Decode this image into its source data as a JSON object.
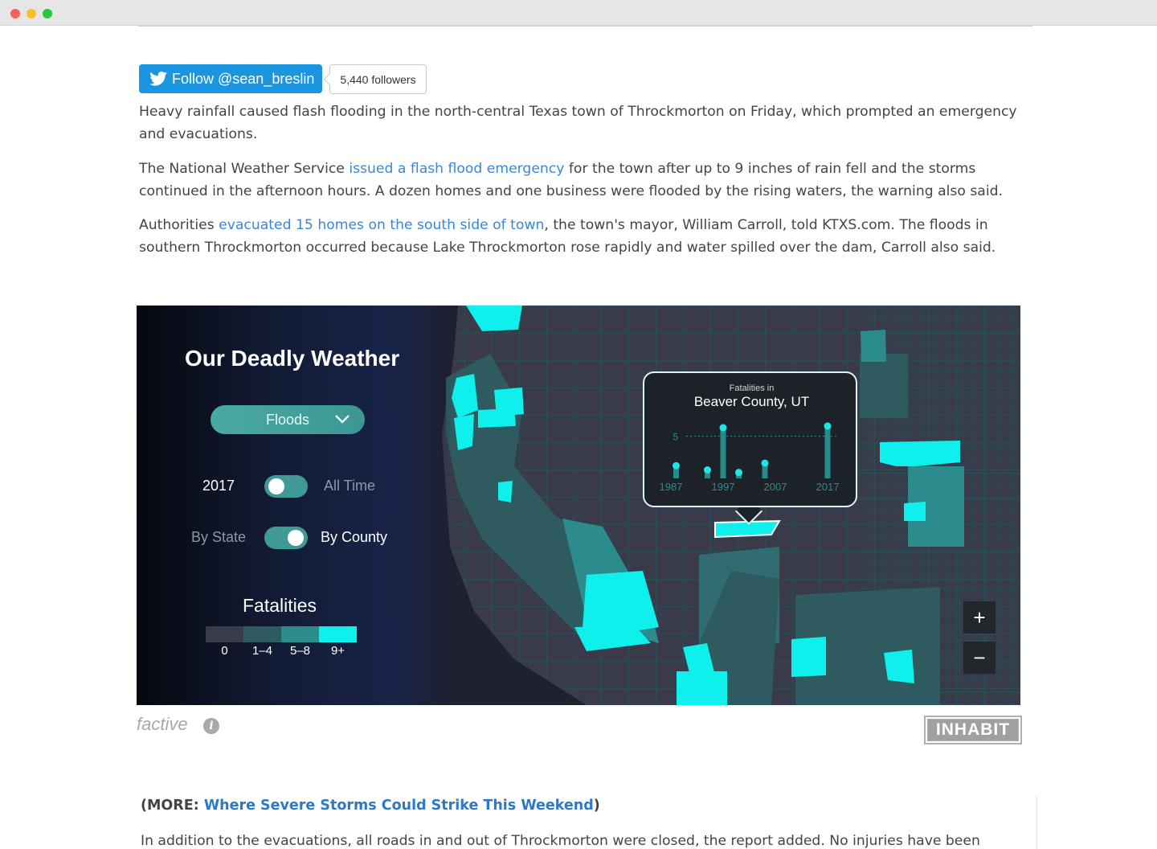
{
  "follow": {
    "label": "Follow @sean_breslin",
    "followers": "5,440 followers"
  },
  "article": {
    "p1": "Heavy rainfall caused flash flooding in the north-central Texas town of Throckmorton on Friday, which prompted an emergency and evacuations.",
    "p2_pre": "The National Weather Service ",
    "p2_link": "issued a flash flood emergency",
    "p2_post": " for the town after up to 9 inches of rain fell and the storms continued in the afternoon hours. A dozen homes and one business were flooded by the rising waters, the warning also said.",
    "p3_pre": "Authorities ",
    "p3_link": "evacuated 15 homes on the south side of town",
    "p3_post": ", the town's mayor, William Carroll, told KTXS.com. The floods in southern Throckmorton occurred because Lake Throckmorton rose rapidly and water spilled over the dam, Carroll also said.",
    "more_prefix": "(MORE: ",
    "more_link": "Where Severe Storms Could Strike This Weekend",
    "more_suffix": ")",
    "p4": "In addition to the evacuations, all roads in and out of Throckmorton were closed, the report added. No injuries have been"
  },
  "widget": {
    "title": "Our Deadly Weather",
    "dropdown": "Floods",
    "toggle1": {
      "left": "2017",
      "right": "All Time",
      "state": "left"
    },
    "toggle2": {
      "left": "By State",
      "right": "By County",
      "state": "right"
    },
    "legend_title": "Fatalities",
    "legend": [
      {
        "label": "0",
        "color": "#3a3b4a"
      },
      {
        "label": "1–4",
        "color": "#2e5b60"
      },
      {
        "label": "5–8",
        "color": "#2c8b8c"
      },
      {
        "label": "9+",
        "color": "#0ff0ec"
      }
    ],
    "tooltip": {
      "subtitle": "Fatalities in",
      "title": "Beaver County, UT",
      "y_tick": "5",
      "x_ticks": [
        "1987",
        "1997",
        "2007",
        "2017"
      ]
    },
    "zoom_in": "+",
    "zoom_out": "−"
  },
  "chart_data": {
    "type": "bar",
    "title": "Beaver County, UT",
    "xlabel": "",
    "ylabel": "",
    "x": [
      1987,
      1988,
      1994,
      1997,
      2000,
      2005,
      2013,
      2017
    ],
    "values": [
      0,
      1.5,
      1,
      6,
      0.7,
      1.8,
      0,
      6.2
    ],
    "y_ticks": [
      5
    ],
    "x_ticks": [
      "1987",
      "1997",
      "2007",
      "2017"
    ]
  },
  "footer": {
    "brand": "factive",
    "badge": "INHABIT"
  }
}
